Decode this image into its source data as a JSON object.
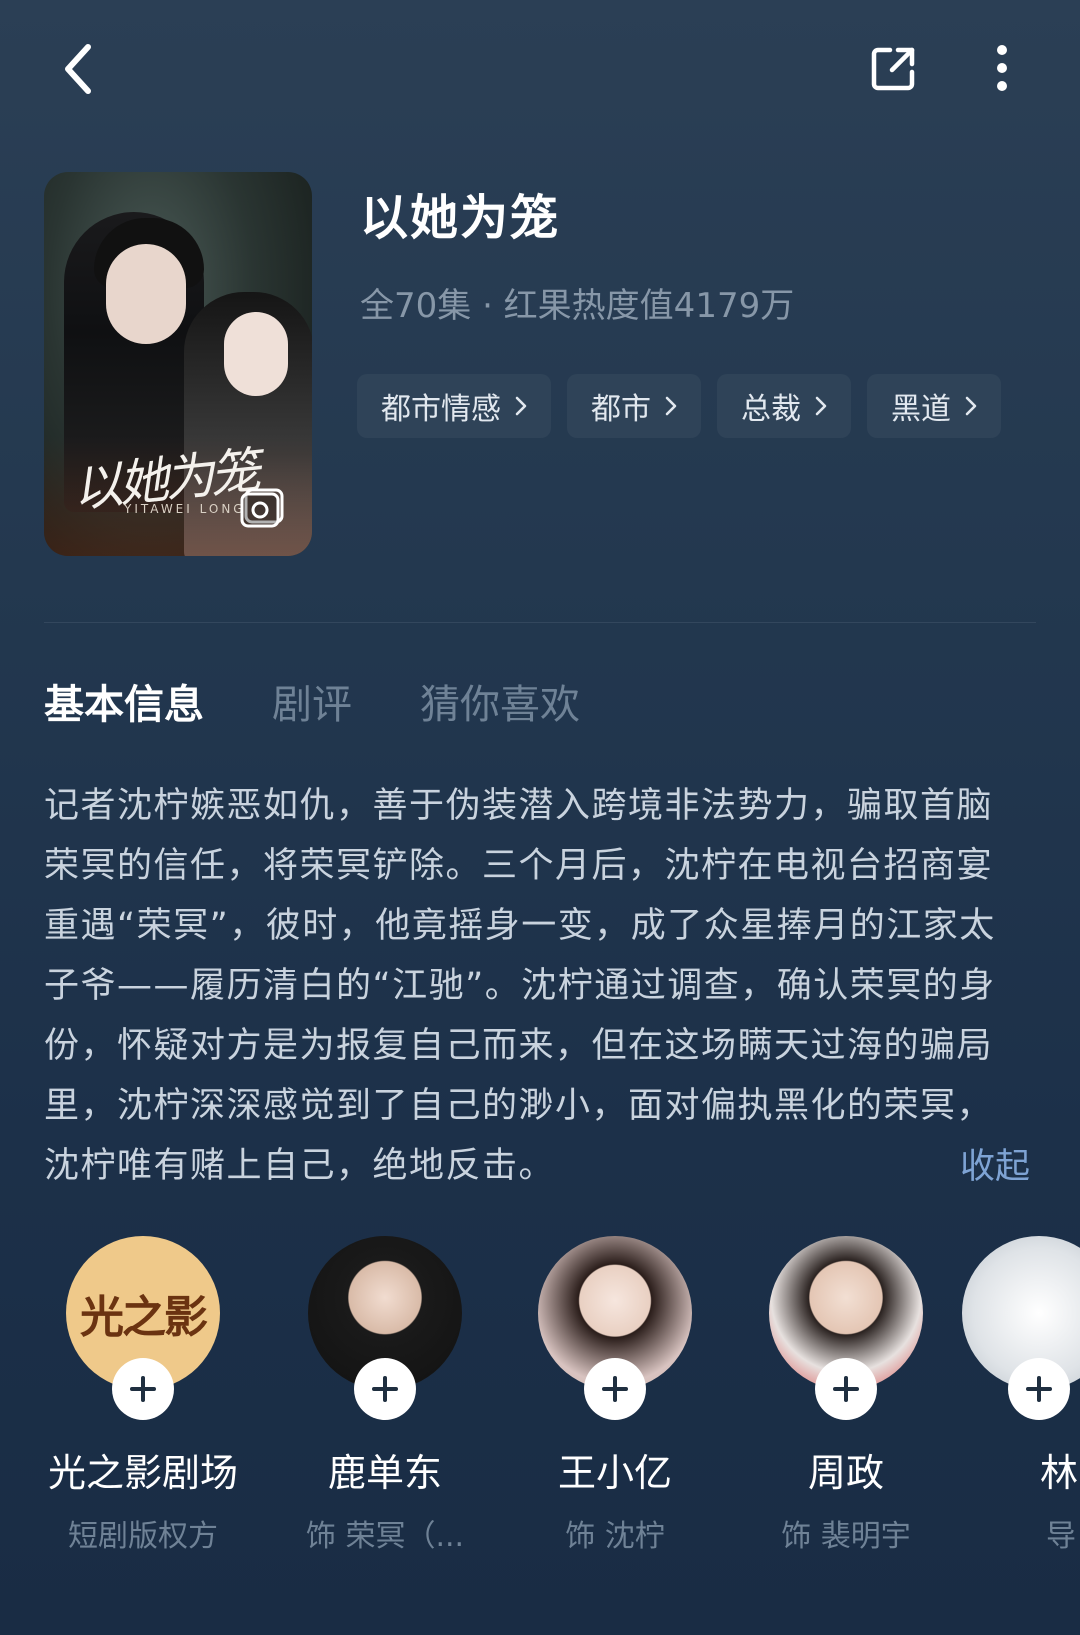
{
  "header": {
    "back_icon": "chevron-left-icon",
    "share_icon": "share-icon",
    "more_icon": "more-vertical-icon"
  },
  "drama": {
    "title": "以她为笼",
    "meta": "全70集 · 红果热度值4179万",
    "tags": [
      {
        "label": "都市情感"
      },
      {
        "label": "都市"
      },
      {
        "label": "总裁"
      },
      {
        "label": "黑道"
      }
    ],
    "poster": {
      "title_art": "以她为笼",
      "subtitle": "YITAWEI LONG"
    }
  },
  "tabs": [
    {
      "label": "基本信息",
      "active": true
    },
    {
      "label": "剧评",
      "active": false
    },
    {
      "label": "猜你喜欢",
      "active": false
    }
  ],
  "description": {
    "text": "记者沈柠嫉恶如仇，善于伪装潜入跨境非法势力，骗取首脑荣冥的信任，将荣冥铲除。三个月后，沈柠在电视台招商宴重遇“荣冥”，彼时，他竟摇身一变，成了众星捧月的江家太子爷——履历清白的“江驰”。沈柠通过调查，确认荣冥的身份，怀疑对方是为报复自己而来，但在这场瞒天过海的骗局里，沈柠深深感觉到了自己的渺小，面对偏执黑化的荣冥，沈柠唯有赌上自己，绝地反击。",
    "collapse_label": "收起"
  },
  "cast": [
    {
      "name": "光之影剧场",
      "role": "短剧版权方",
      "logo_text": "光之影"
    },
    {
      "name": "鹿单东",
      "role": "饰 荣冥（..."
    },
    {
      "name": "王小亿",
      "role": "饰 沈柠"
    },
    {
      "name": "周政",
      "role": "饰 裴明宇"
    },
    {
      "name": "林",
      "role": "导"
    }
  ],
  "colors": {
    "accent_link": "#7ea3d4",
    "tag_bg": "#2f4358",
    "muted_text": "#6f8296"
  }
}
